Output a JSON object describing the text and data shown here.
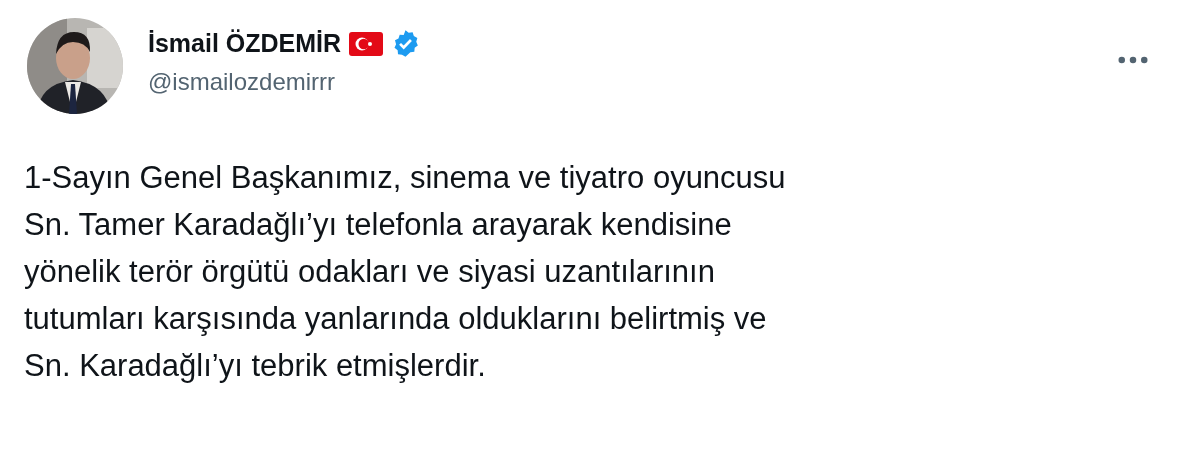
{
  "author": {
    "name": "İsmail ÖZDEMİR",
    "handle": "@ismailozdemirrr",
    "verified": true
  },
  "tweet": {
    "text": "1-Sayın Genel Başkanımız, sinema ve tiyatro oyuncusu\nSn. Tamer Karadağlı’yı telefonla arayarak kendisine\nyönelik terör örgütü odakları ve siyasi uzantılarının\ntutumları karşısında yanlarında olduklarını belirtmiş ve\nSn. Karadağlı’yı tebrik etmişlerdir."
  }
}
